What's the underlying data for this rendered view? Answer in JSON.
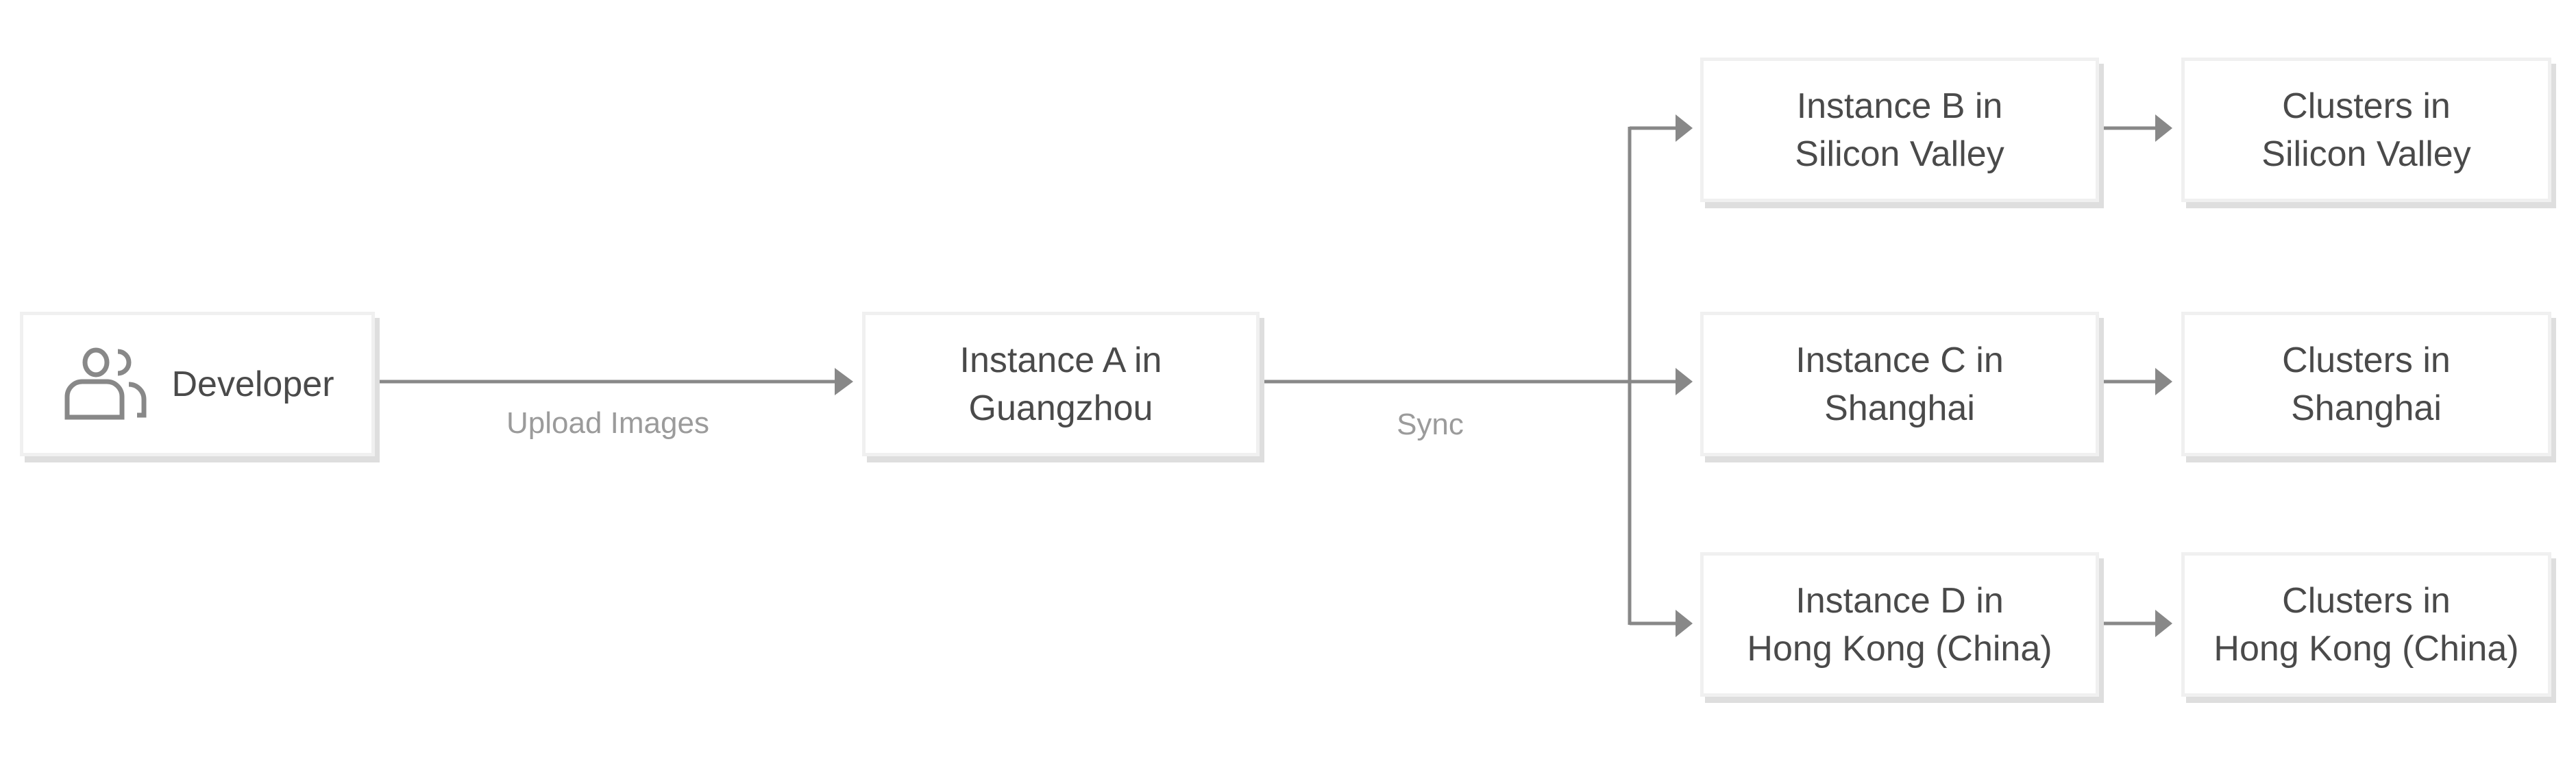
{
  "nodes": {
    "developer": "Developer",
    "instance_a": "Instance A in\nGuangzhou",
    "instance_b": "Instance B in\nSilicon Valley",
    "instance_c": "Instance C in\nShanghai",
    "instance_d": "Instance D in\nHong Kong (China)",
    "clusters_b": "Clusters in\nSilicon Valley",
    "clusters_c": "Clusters in\nShanghai",
    "clusters_d": "Clusters in\nHong Kong (China)"
  },
  "edges": {
    "upload": "Upload Images",
    "sync": "Sync"
  },
  "icons": {
    "developer": "users-icon"
  },
  "colors": {
    "text": "#4a4a4a",
    "label": "#9b9b9b",
    "line": "#888888"
  }
}
